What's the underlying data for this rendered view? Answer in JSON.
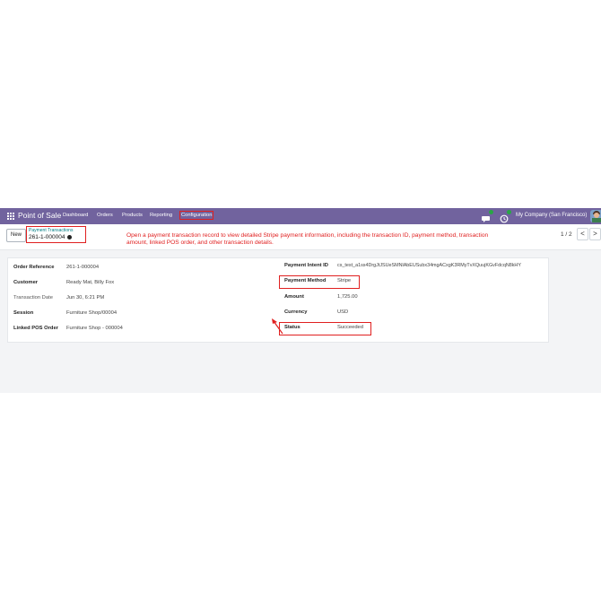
{
  "navbar": {
    "app_name": "Point of Sale",
    "menu": [
      "Dashboard",
      "Orders",
      "Products",
      "Reporting",
      "Configuration"
    ],
    "company": "My Company (San Francisco)",
    "chat_icon": "chat-icon",
    "activity_icon": "activity-clock-icon",
    "accent": "#71639e"
  },
  "control": {
    "new_label": "New",
    "breadcrumb_parent": "Payment Transactions",
    "breadcrumb_current": "261-1-000004",
    "pager": "1 / 2",
    "prev": "<",
    "next": ">"
  },
  "annotation": "Open a payment transaction record to view detailed Stripe payment information, including the transaction ID, payment method, transaction amount, linked POS order, and other transaction details.",
  "form": {
    "left": [
      {
        "label": "Order Reference",
        "value": "261-1-000004"
      },
      {
        "label": "Customer",
        "value": "Ready Mat, Billy Fox"
      },
      {
        "label": "Transaction Date",
        "value": "Jun 30, 6:21 PM"
      },
      {
        "label": "Session",
        "value": "Furniture Shop/00004"
      },
      {
        "label": "Linked POS Order",
        "value": "Furniture Shop - 000004"
      }
    ],
    "right": [
      {
        "label": "Payment Intent ID",
        "value": "cs_test_a1ss4DrgJtJSUeSMNlAbEUSubx34mgACxgK3RMyTvXQuujKGvFdcqN8kHY"
      },
      {
        "label": "Payment Method",
        "value": "Stripe"
      },
      {
        "label": "Amount",
        "value": "1,725.00"
      },
      {
        "label": "Currency",
        "value": "USD"
      },
      {
        "label": "Status",
        "value": "Succeeded"
      }
    ]
  },
  "colors": {
    "highlight": "#e02020",
    "link": "#017e84"
  }
}
